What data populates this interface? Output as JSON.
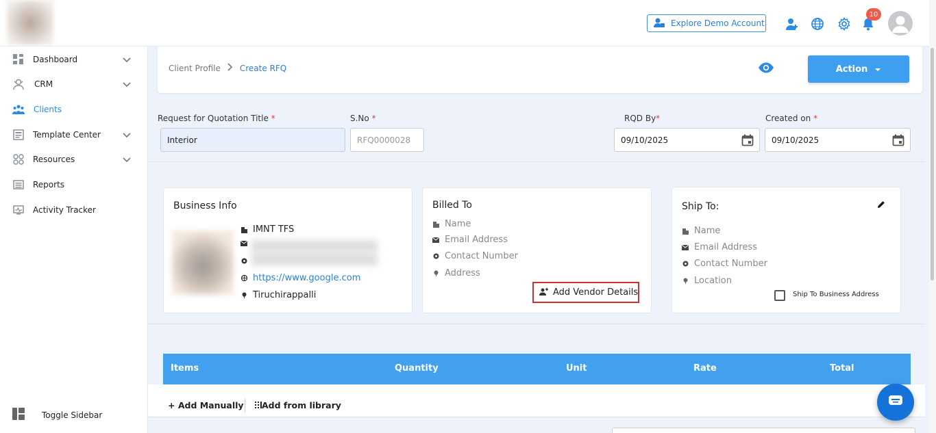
{
  "header": {
    "explore_label": "Explore Demo Account",
    "notification_count": "10"
  },
  "sidebar": {
    "items": [
      {
        "label": "Dashboard",
        "icon": "dashboard-icon",
        "expandable": true
      },
      {
        "label": "CRM",
        "icon": "crm-icon",
        "expandable": true
      },
      {
        "label": "Clients",
        "icon": "clients-icon",
        "expandable": false,
        "active": true
      },
      {
        "label": "Template Center",
        "icon": "template-icon",
        "expandable": true
      },
      {
        "label": "Resources",
        "icon": "resources-icon",
        "expandable": true
      },
      {
        "label": "Reports",
        "icon": "reports-icon",
        "expandable": false
      },
      {
        "label": "Activity Tracker",
        "icon": "activity-icon",
        "expandable": false
      }
    ],
    "toggle_label": "Toggle Sidebar"
  },
  "breadcrumb": {
    "parent": "Client Profile",
    "current": "Create RFQ"
  },
  "action_label": "Action",
  "form": {
    "title_label": "Request for Quotation Title",
    "title_value": "Interior",
    "sno_label": "S.No",
    "sno_placeholder": "RFQ0000028",
    "rqd_label": "RQD By",
    "rqd_value": "09/10/2025",
    "created_label": "Created on",
    "created_value": "09/10/2025",
    "required_mark": "*"
  },
  "business": {
    "title": "Business Info",
    "name": "IMNT TFS",
    "website": "https://www.google.com",
    "city": "Tiruchirappalli"
  },
  "billed": {
    "title": "Billed To",
    "name": "Name",
    "email": "Email Address",
    "contact": "Contact Number",
    "address": "Address",
    "vendor_button": "Add Vendor Details"
  },
  "ship": {
    "title": "Ship To:",
    "name": "Name",
    "email": "Email Address",
    "contact": "Contact Number",
    "location": "Location",
    "checkbox_label": "Ship To Business Address"
  },
  "table": {
    "columns": [
      "Items",
      "Quantity",
      "Unit",
      "Rate",
      "Total"
    ],
    "add_manual": "+ Add Manually",
    "add_library": "Add from library"
  },
  "colors": {
    "accent": "#3e9ff0",
    "link": "#2a7fd8",
    "badge": "#f05a4a",
    "highlight_border": "#d32f2f"
  }
}
